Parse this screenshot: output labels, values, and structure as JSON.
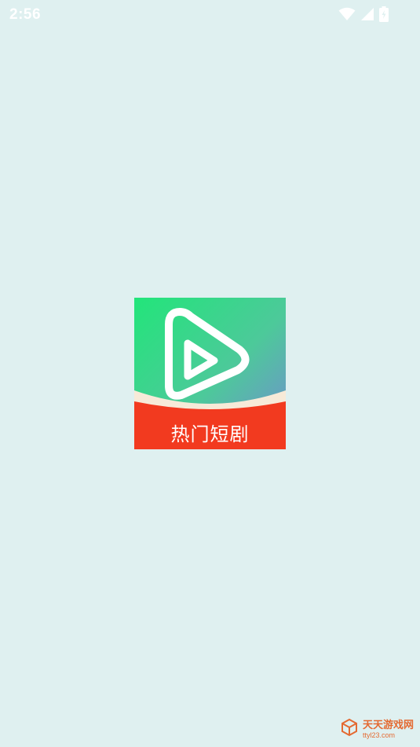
{
  "status_bar": {
    "time": "2:56",
    "icons": [
      "wifi-icon",
      "cellular-signal-icon",
      "battery-charging-icon"
    ]
  },
  "splash": {
    "app_name": "热门短剧",
    "colors": {
      "background": "#dff0f0",
      "gradient_start": "#28e07a",
      "gradient_end": "#6c8fd6",
      "band_red": "#f23a1f",
      "band_cream": "#f7ead8"
    }
  },
  "watermark": {
    "title": "天天游戏网",
    "url": "ttyl23.com",
    "color": "#e46a32"
  }
}
